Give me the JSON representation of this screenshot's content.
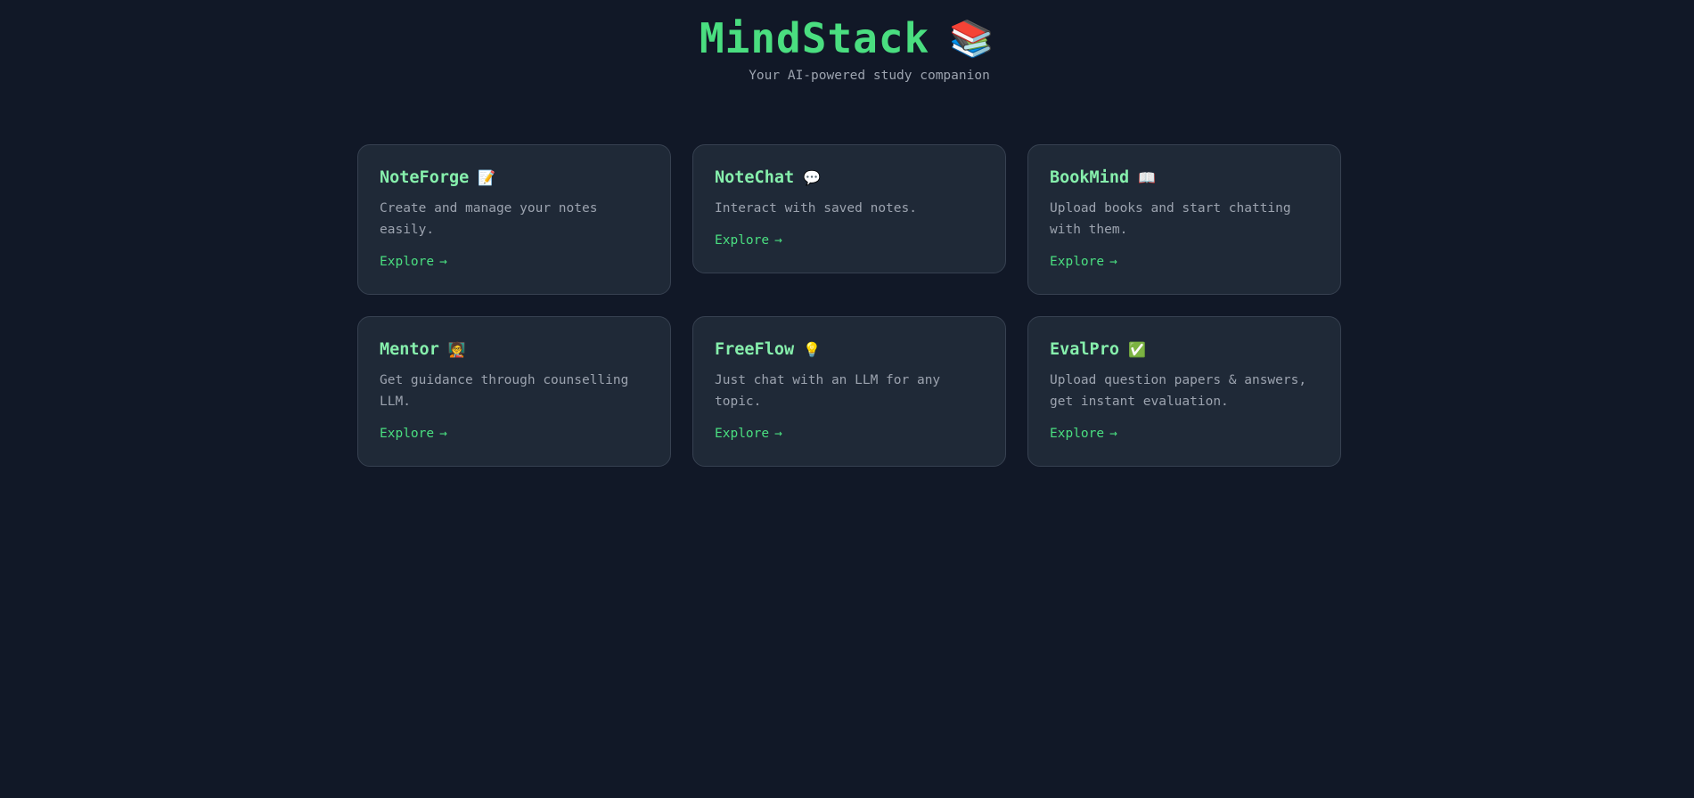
{
  "header": {
    "title": "MindStack",
    "title_emoji": "📚",
    "subtitle": "Your AI-powered study companion"
  },
  "colors": {
    "background": "#111827",
    "card_background": "#1f2937",
    "card_border": "#374151",
    "accent": "#4ade80",
    "card_title": "#86efac",
    "muted_text": "#9ca3af"
  },
  "cards": [
    {
      "title": "NoteForge",
      "emoji": "📝",
      "icon": "memo-icon",
      "description": "Create and manage your notes easily.",
      "link_label": "Explore",
      "link_arrow": "→"
    },
    {
      "title": "NoteChat",
      "emoji": "💬",
      "icon": "speech-bubble-icon",
      "description": "Interact with saved notes.",
      "link_label": "Explore",
      "link_arrow": "→"
    },
    {
      "title": "BookMind",
      "emoji": "📖",
      "icon": "open-book-icon",
      "description": "Upload books and start chatting with them.",
      "link_label": "Explore",
      "link_arrow": "→"
    },
    {
      "title": "Mentor",
      "emoji": "🧑‍🏫",
      "icon": "teacher-icon",
      "description": "Get guidance through counselling LLM.",
      "link_label": "Explore",
      "link_arrow": "→"
    },
    {
      "title": "FreeFlow",
      "emoji": "💡",
      "icon": "light-bulb-icon",
      "description": "Just chat with an LLM for any topic.",
      "link_label": "Explore",
      "link_arrow": "→"
    },
    {
      "title": "EvalPro",
      "emoji": "✅",
      "icon": "check-mark-icon",
      "description": "Upload question papers & answers, get instant evaluation.",
      "link_label": "Explore",
      "link_arrow": "→"
    }
  ]
}
